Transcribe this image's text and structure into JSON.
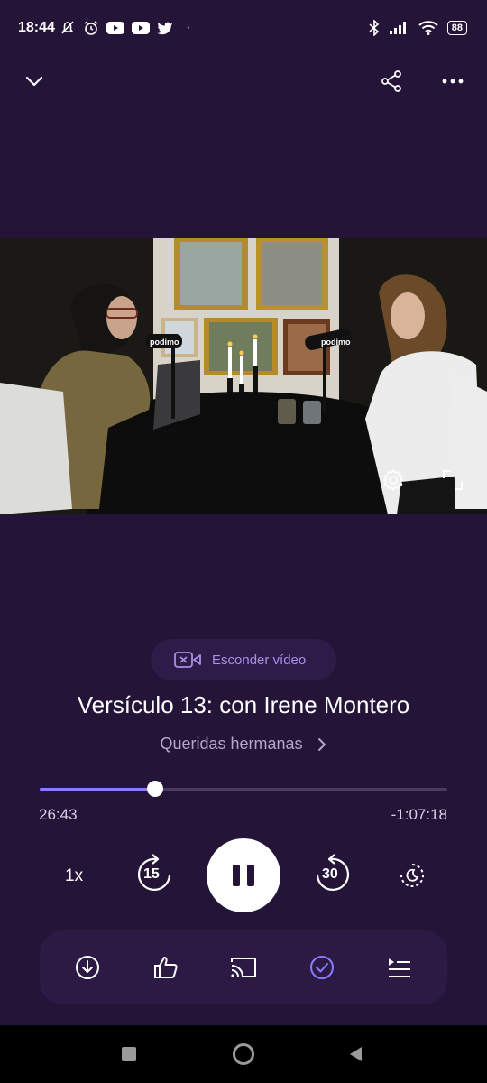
{
  "status_bar": {
    "time": "18:44",
    "battery": "88"
  },
  "header": {
    "collapse_icon": "chevron-down-icon",
    "share_icon": "share-icon",
    "more_icon": "more-horizontal-icon"
  },
  "video": {
    "settings_icon": "gear-icon",
    "fullscreen_icon": "fullscreen-icon"
  },
  "hide_video": {
    "label": "Esconder vídeo",
    "icon": "video-off-icon"
  },
  "episode": {
    "title": "Versículo 13: con Irene Montero",
    "show": "Queridas hermanas"
  },
  "progress": {
    "elapsed": "26:43",
    "remaining": "-1:07:18",
    "fraction": 0.283
  },
  "controls": {
    "speed": "1x",
    "rewind": "15",
    "forward": "30",
    "play_state": "playing",
    "sleep_icon": "sleep-timer-icon"
  },
  "actions": [
    {
      "icon": "download-icon",
      "active": false
    },
    {
      "icon": "thumbs-up-icon",
      "active": false
    },
    {
      "icon": "cast-icon",
      "active": false
    },
    {
      "icon": "check-circle-icon",
      "active": true
    },
    {
      "icon": "queue-icon",
      "active": false
    }
  ],
  "colors": {
    "background": "#241438",
    "accent": "#8b7bff",
    "pill_text": "#a98ee8",
    "secondary_text": "#b3a7c4"
  }
}
